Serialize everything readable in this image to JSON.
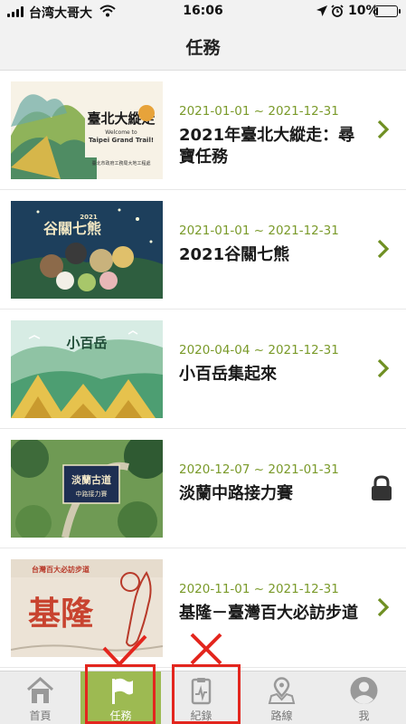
{
  "status_bar": {
    "carrier": "台湾大哥大",
    "time": "16:06",
    "battery": "10%",
    "battery_level": 0.1
  },
  "nav": {
    "title": "任務"
  },
  "tasks": [
    {
      "dates": "2021-01-01 ~ 2021-12-31",
      "name": "2021年臺北大縱走：尋寶任務",
      "accessory": "chevron",
      "image": {
        "title": "臺北大縱走",
        "welcome": "Welcome to",
        "subtitle": "Taipei Grand Trail!",
        "publisher": "臺北市政府工務局大地工程處"
      }
    },
    {
      "dates": "2021-01-01 ~ 2021-12-31",
      "name": "2021谷關七熊",
      "accessory": "chevron",
      "image": {
        "title": "谷關七熊",
        "year": "2021"
      }
    },
    {
      "dates": "2020-04-04 ~ 2021-12-31",
      "name": "小百岳集起來",
      "accessory": "chevron",
      "image": {
        "title": "小百岳"
      }
    },
    {
      "dates": "2020-12-07 ~ 2021-01-31",
      "name": "淡蘭中路接力賽",
      "accessory": "lock",
      "image": {
        "title": "淡蘭古道",
        "subtitle": "中路接力賽"
      }
    },
    {
      "dates": "2020-11-01 ~ 2021-12-31",
      "name": "基隆－臺灣百大必訪步道",
      "accessory": "chevron",
      "image": {
        "title": "基隆",
        "subtitle": "台灣百大必訪步道"
      }
    }
  ],
  "tabbar": {
    "tabs": [
      {
        "label": "首頁",
        "icon": "home-icon"
      },
      {
        "label": "任務",
        "icon": "flag-icon",
        "active": true
      },
      {
        "label": "紀錄",
        "icon": "clipboard-icon"
      },
      {
        "label": "路線",
        "icon": "map-pin-icon"
      },
      {
        "label": "我",
        "icon": "person-icon"
      }
    ]
  },
  "colors": {
    "accent_green": "#9dba52",
    "date_green": "#7a9a2a",
    "annotation_red": "#e3261e"
  }
}
